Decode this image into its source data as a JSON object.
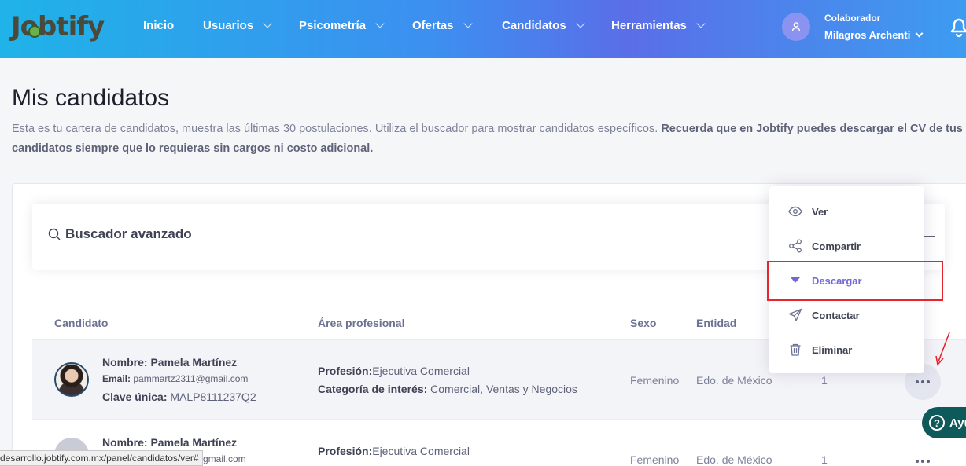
{
  "header": {
    "logo": "Jobtify",
    "nav": [
      {
        "label": "Inicio",
        "dropdown": false
      },
      {
        "label": "Usuarios",
        "dropdown": true
      },
      {
        "label": "Psicometría",
        "dropdown": true
      },
      {
        "label": "Ofertas",
        "dropdown": true
      },
      {
        "label": "Candidatos",
        "dropdown": true
      },
      {
        "label": "Herramientas",
        "dropdown": true
      }
    ],
    "user": {
      "role": "Colaborador",
      "name": "Milagros Archenti"
    }
  },
  "page": {
    "title": "Mis candidatos",
    "description": "Esta es tu cartera de candidatos, muestra las últimas 30 postulaciones. Utiliza el buscador para mostrar candidatos específicos. ",
    "description_bold": "Recuerda que en Jobtify puedes descargar el CV de tus candidatos siempre que lo requieras sin cargos ni costo adicional."
  },
  "search": {
    "label": "Buscador avanzado"
  },
  "table": {
    "headers": {
      "candidate": "Candidato",
      "area": "Área profesional",
      "sex": "Sexo",
      "state": "Entidad"
    },
    "rows": [
      {
        "name_label": "Nombre:",
        "name": "Pamela Martínez",
        "email_label": "Email:",
        "email": "pammartz2311@gmail.com",
        "key_label": "Clave única:",
        "key": "MALP8111237Q2",
        "profession_label": "Profesión:",
        "profession": "Ejecutiva Comercial",
        "category_label": "Categoría de interés:",
        "category": "Comercial, Ventas y Negocios",
        "sex": "Femenino",
        "state": "Edo. de México",
        "count": "1"
      },
      {
        "name_label": "Nombre:",
        "name": "Pamela Martínez",
        "email_visible": "gmail.com",
        "profession_label": "Profesión:",
        "profession": "Ejecutiva Comercial",
        "sex": "Femenino",
        "state": "Edo. de México",
        "count": "1"
      }
    ]
  },
  "menu": {
    "items": [
      {
        "label": "Ver",
        "icon": "eye-icon"
      },
      {
        "label": "Compartir",
        "icon": "share-icon"
      },
      {
        "label": "Descargar",
        "icon": "caret-down-icon",
        "active": true
      },
      {
        "label": "Contactar",
        "icon": "send-icon"
      },
      {
        "label": "Eliminar",
        "icon": "trash-icon"
      }
    ]
  },
  "help": {
    "label": "Ayu"
  },
  "status_url": "desarrollo.jobtify.com.mx/panel/candidatos/ver#",
  "colors": {
    "accent": "#7167d9",
    "highlight": "#e8242f",
    "help": "#0e5a5a"
  }
}
